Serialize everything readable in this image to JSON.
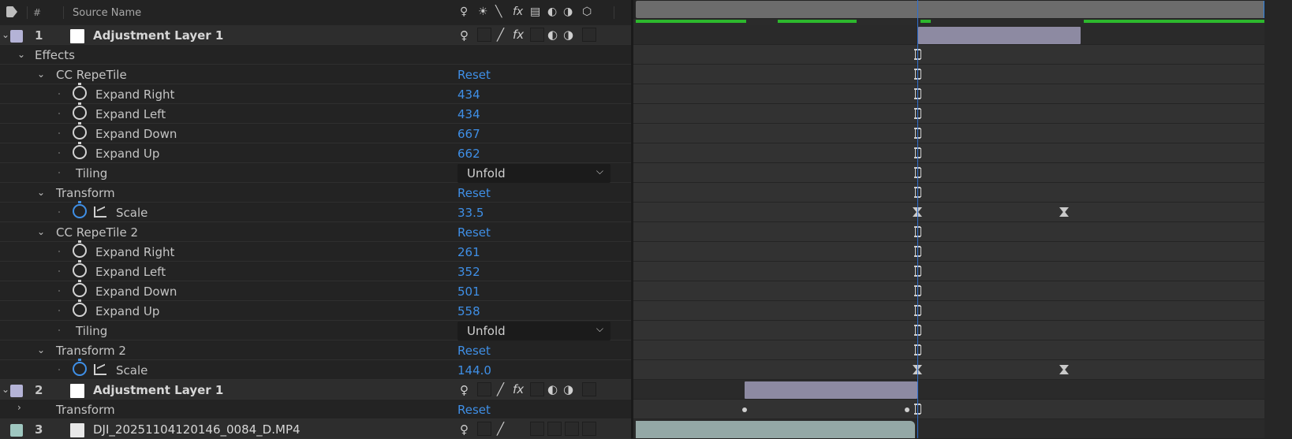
{
  "header": {
    "hash": "#",
    "source_name": "Source Name",
    "switches": [
      "♀",
      "☀",
      "╲",
      "fx",
      "▤",
      "◐",
      "◑",
      "⬡"
    ]
  },
  "layers": [
    {
      "num": "1",
      "name": "Adjustment Layer 1",
      "chip_color": "#b4b3d6"
    },
    {
      "num": "2",
      "name": "Adjustment Layer 1",
      "chip_color": "#b4b3d6"
    },
    {
      "num": "3",
      "name": "DJI_20251104120146_0084_D.MP4",
      "chip_color": "#9fc7c0"
    }
  ],
  "effects_group": "Effects",
  "effect1": {
    "name": "CC RepeTile",
    "reset": "Reset",
    "props": [
      {
        "label": "Expand Right",
        "value": "434"
      },
      {
        "label": "Expand Left",
        "value": "434"
      },
      {
        "label": "Expand Down",
        "value": "667"
      },
      {
        "label": "Expand Up",
        "value": "662"
      }
    ],
    "tiling_label": "Tiling",
    "tiling_value": "Unfold"
  },
  "transform1": {
    "name": "Transform",
    "reset": "Reset",
    "scale_label": "Scale",
    "scale_value": "33.5"
  },
  "effect2": {
    "name": "CC RepeTile 2",
    "reset": "Reset",
    "props": [
      {
        "label": "Expand Right",
        "value": "261"
      },
      {
        "label": "Expand Left",
        "value": "352"
      },
      {
        "label": "Expand Down",
        "value": "501"
      },
      {
        "label": "Expand Up",
        "value": "558"
      }
    ],
    "tiling_label": "Tiling",
    "tiling_value": "Unfold"
  },
  "transform2": {
    "name": "Transform 2",
    "reset": "Reset",
    "scale_label": "Scale",
    "scale_value": "144.0"
  },
  "layer2_transform": {
    "name": "Transform",
    "reset": "Reset"
  },
  "colors": {
    "value_blue": "#3f8fe6",
    "cti_blue": "#2f6fd0",
    "cache_green": "#2db82d",
    "clip_purple": "#8d8aa2",
    "clip_teal": "#94a8a6"
  }
}
